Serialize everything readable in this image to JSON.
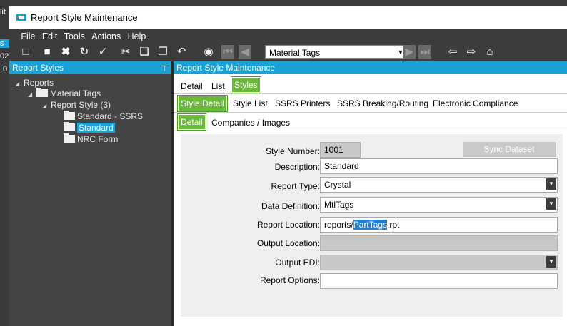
{
  "edge": {
    "t1": "lit",
    "t2": "s",
    "t3": "02",
    "t4": "0"
  },
  "window": {
    "title": "Report Style Maintenance"
  },
  "menu": [
    "File",
    "Edit",
    "Tools",
    "Actions",
    "Help"
  ],
  "toolbar": {
    "nav_value": "Material Tags"
  },
  "left_panel": {
    "title": "Report Styles",
    "tree": {
      "root": "Reports",
      "group": "Material Tags",
      "sub": "Report Style (3)",
      "items": [
        "Standard - SSRS",
        "Standard",
        "NRC Form"
      ]
    }
  },
  "right_panel": {
    "title": "Report Style Maintenance",
    "tabs_main": [
      "Detail",
      "List",
      "Styles"
    ],
    "tabs_sub": [
      "Style Detail",
      "Style List",
      "SSRS Printers",
      "SSRS Breaking/Routing",
      "Electronic Compliance"
    ],
    "tabs_inner": [
      "Detail",
      "Companies / Images"
    ]
  },
  "form": {
    "style_number_label": "Style Number:",
    "style_number": "1001",
    "sync_button": "Sync Dataset",
    "description_label": "Description:",
    "description": "Standard",
    "report_type_label": "Report Type:",
    "report_type": "Crystal",
    "data_definition_label": "Data Definition:",
    "data_definition": "MtlTags",
    "report_location_label": "Report Location:",
    "report_location_pre": "reports/",
    "report_location_sel": "PartTags",
    "report_location_post": ".rpt",
    "output_location_label": "Output Location:",
    "output_location": "",
    "output_edi_label": "Output EDI:",
    "output_edi": "",
    "report_options_label": "Report Options:",
    "report_options": ""
  }
}
